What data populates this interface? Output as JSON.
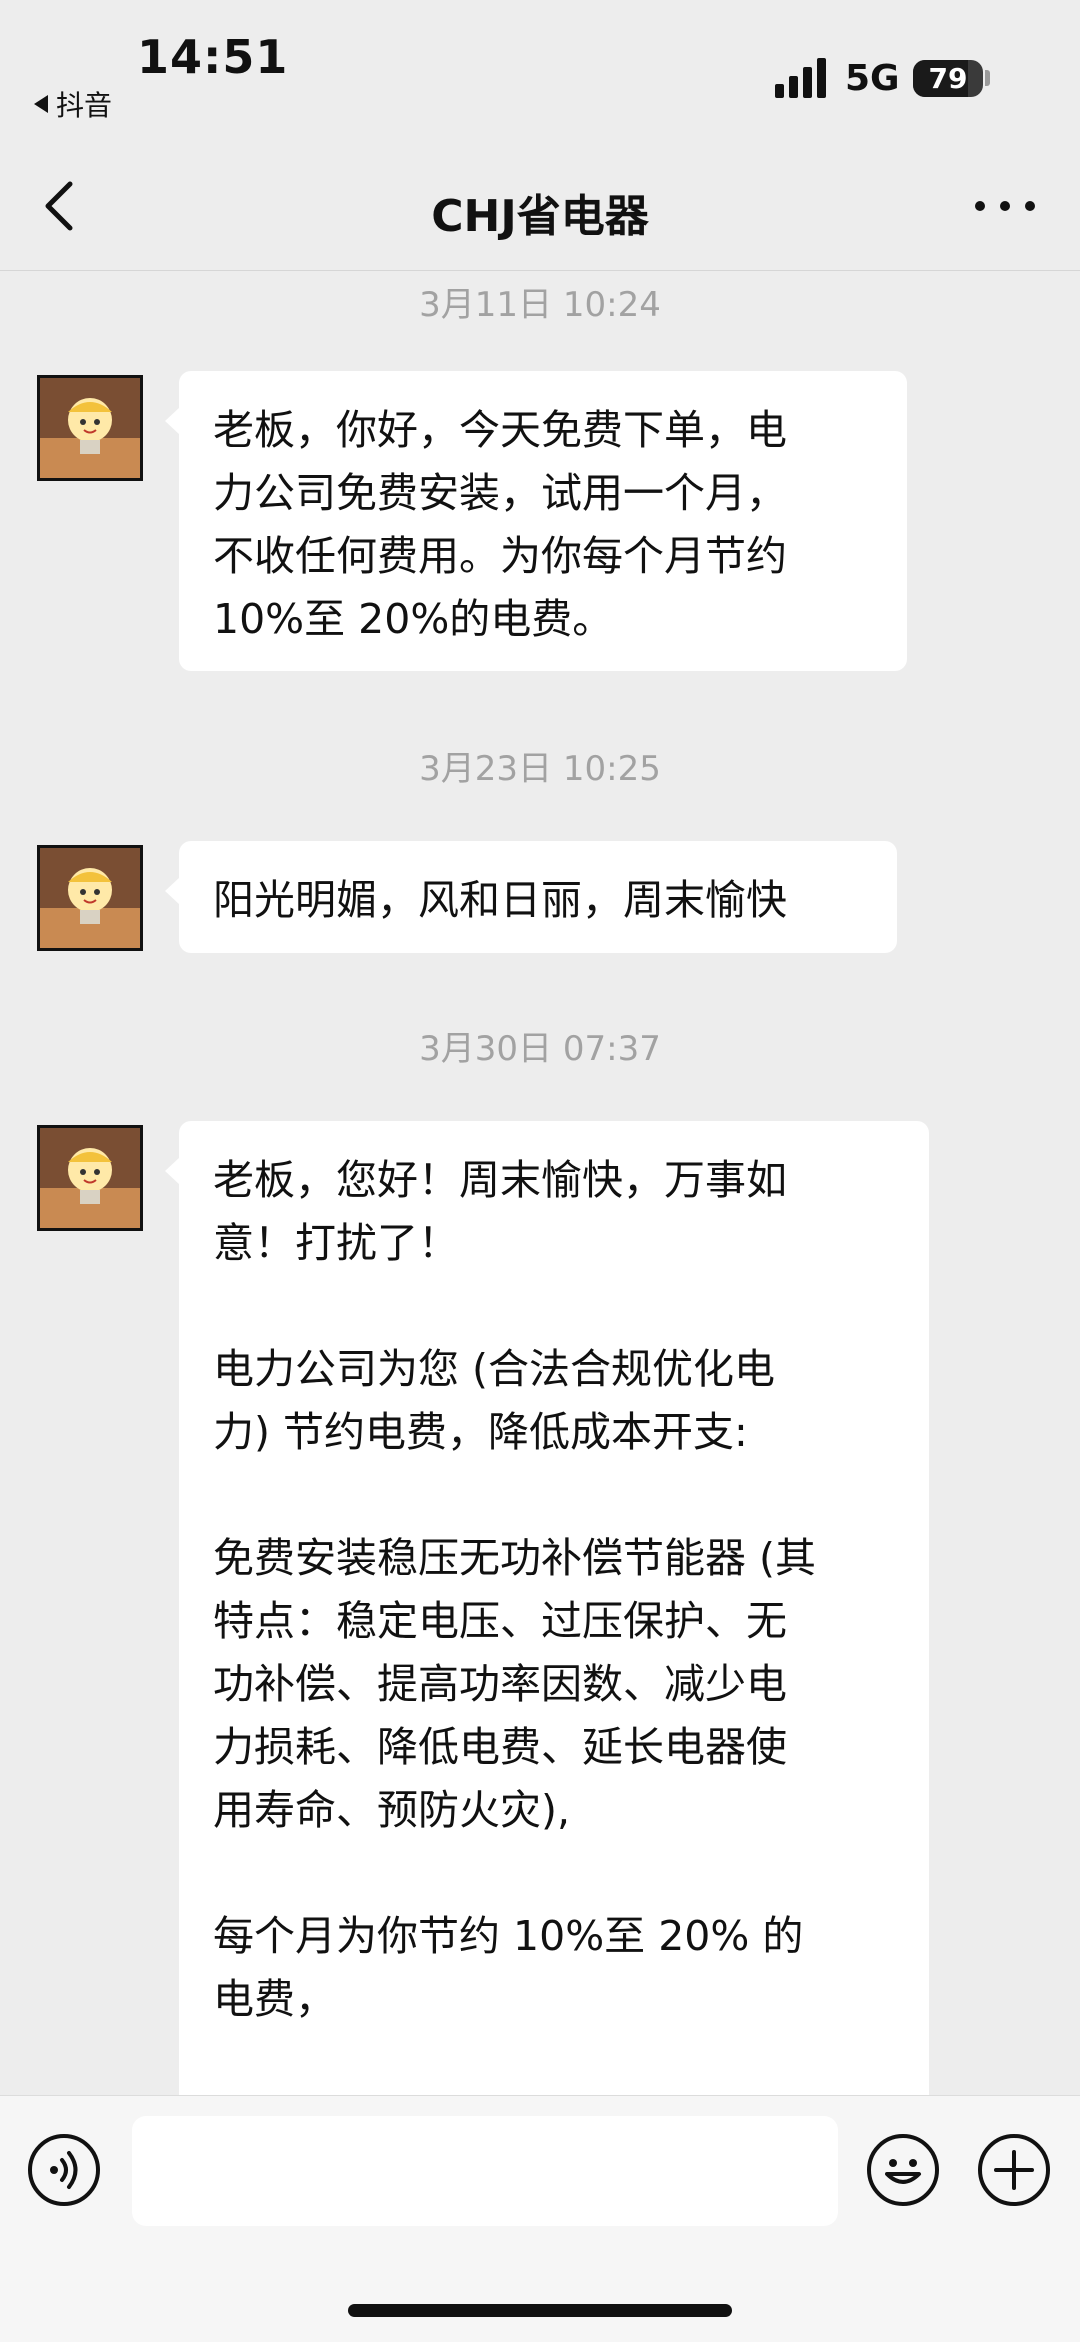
{
  "status_bar": {
    "time": "14:51",
    "back_app": "抖音",
    "network": "5G",
    "battery": "79",
    "battery_level": 0.79
  },
  "nav": {
    "title": "CHJ省电器"
  },
  "messages": [
    {
      "timestamp": "3月11日 10:24",
      "text": "老板，你好，今天免费下单，电\n力公司免费安装，试用一个月，\n不收任何费用。为你每个月节约\n10%至 20%的电费。"
    },
    {
      "timestamp": "3月23日 10:25",
      "text": "阳光明媚，风和日丽，周末愉快"
    },
    {
      "timestamp": "3月30日 07:37",
      "text": "老板，您好！周末愉快，万事如\n意！打扰了！\n\n电力公司为您 (合法合规优化电\n力) 节约电费，降低成本开支:\n\n免费安装稳压无功补偿节能器 (其\n特点：稳定电压、过压保护、无\n功补偿、提高功率因数、减少电\n力损耗、降低电费、延长电器使\n用寿命、预防火灾),\n\n每个月为你节约 10%至 20% 的\n电费，\n\n"
    }
  ],
  "input_bar": {
    "message_placeholder": ""
  },
  "icons": {
    "voice": "voice-icon",
    "emoji": "emoji-icon",
    "plus": "plus-icon"
  },
  "colors": {
    "chat_background": "#ededed",
    "bubble_background": "#ffffff",
    "timestamp_text": "#a2a2a2"
  }
}
